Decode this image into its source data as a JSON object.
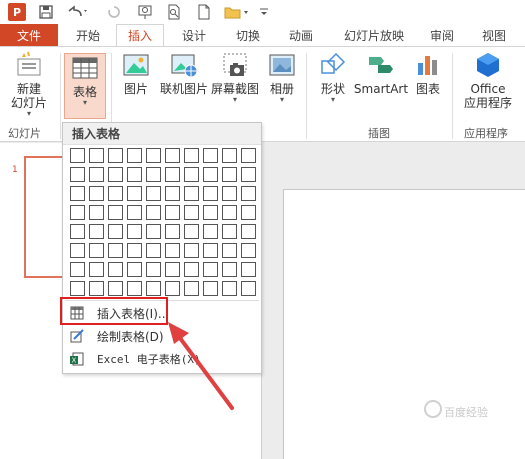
{
  "tabs": {
    "file": "文件",
    "home": "开始",
    "insert": "插入",
    "design": "设计",
    "transitions": "切换",
    "animations": "动画",
    "slideshow": "幻灯片放映",
    "review": "审阅",
    "view": "视图"
  },
  "ribbon": {
    "new_slide": [
      "新建",
      "幻灯片"
    ],
    "table": "表格",
    "pictures": "图片",
    "online_pictures": "联机图片",
    "screenshot": "屏幕截图",
    "album": "相册",
    "shapes": "形状",
    "smartart": "SmartArt",
    "chart": "图表",
    "office_apps": [
      "Office",
      "应用程序"
    ],
    "groups": {
      "slides": "幻灯片",
      "illustrations": "插图",
      "apps": "应用程序"
    }
  },
  "slide_panel": {
    "slide_number": "1"
  },
  "table_dropdown": {
    "header": "插入表格",
    "grid": {
      "columns": 10,
      "rows": 8
    },
    "items": [
      {
        "label": "插入表格(I)...",
        "icon": "insert-table-icon"
      },
      {
        "label": "绘制表格(D)",
        "icon": "draw-table-icon"
      },
      {
        "label": "Excel 电子表格(X)",
        "icon": "excel-icon"
      }
    ]
  },
  "watermark": "百度经验",
  "colors": {
    "accent": "#d24726",
    "highlight_box": "#e02020",
    "arrow": "#e04040"
  }
}
